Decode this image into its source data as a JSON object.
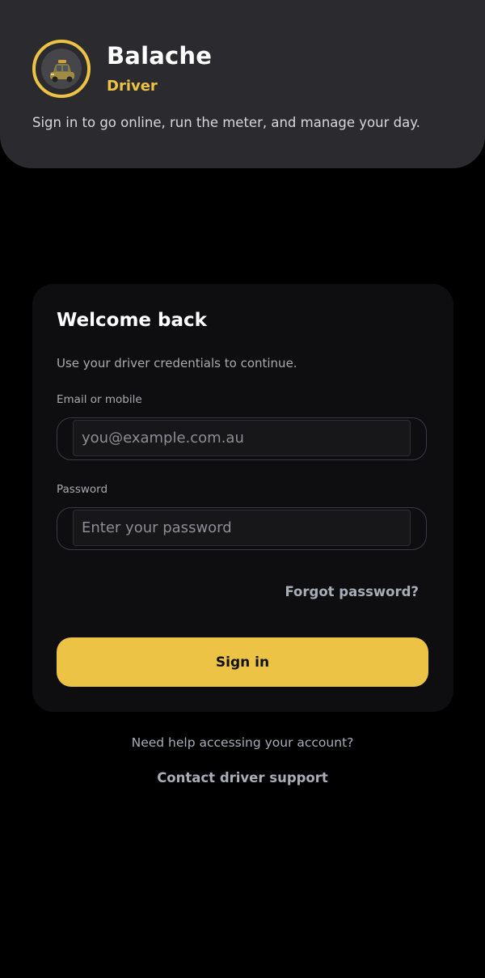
{
  "header": {
    "app_name": "Balache",
    "role": "Driver",
    "tagline": "Sign in to go online, run the meter, and manage your day."
  },
  "login": {
    "title": "Welcome back",
    "subtitle": "Use your driver credentials to continue.",
    "email_label": "Email or mobile",
    "email_placeholder": "you@example.com.au",
    "email_value": "",
    "password_label": "Password",
    "password_placeholder": "Enter your password",
    "password_value": "",
    "forgot_label": "Forgot password?",
    "submit_label": "Sign in"
  },
  "footer": {
    "help_text": "Need help accessing your account?",
    "support_link": "Contact driver support"
  },
  "icons": {
    "avatar": "taxi-car-icon"
  },
  "colors": {
    "accent": "#ecc345",
    "background": "#000000",
    "header_bg": "#2b2a2f",
    "card_bg": "#0e0e10"
  }
}
